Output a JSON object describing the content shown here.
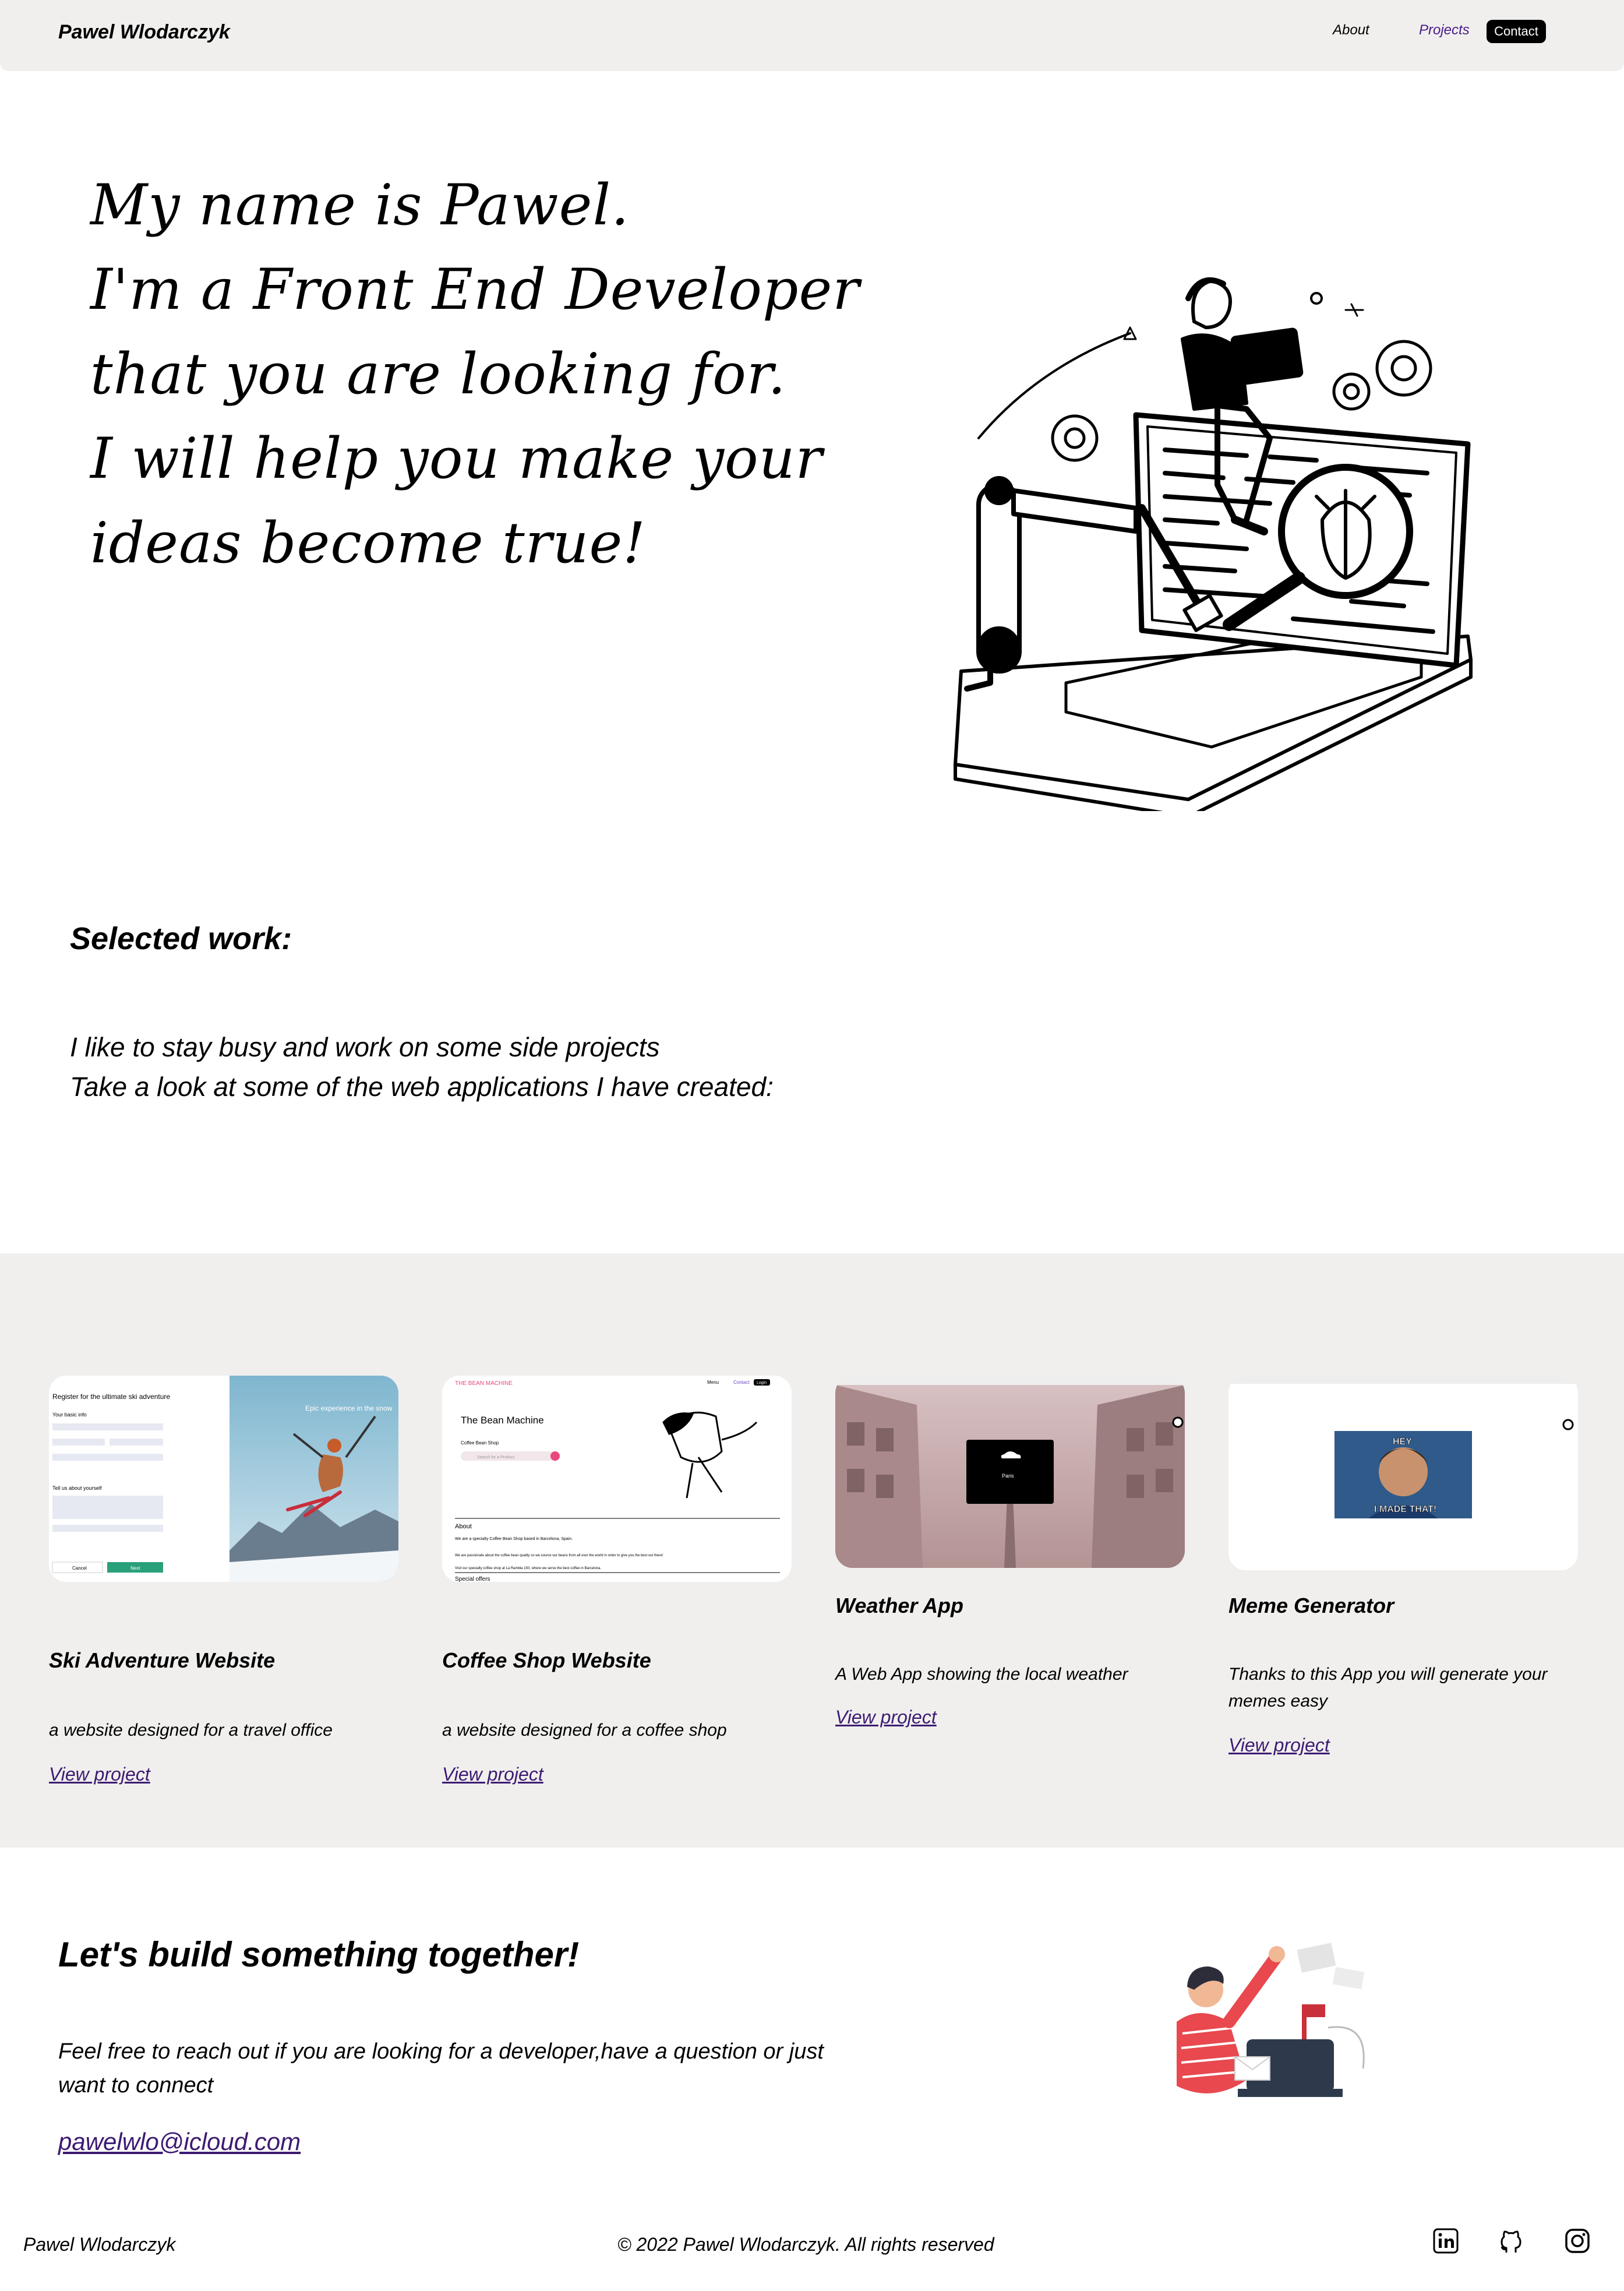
{
  "header": {
    "brand": "Pawel Wlodarczyk",
    "nav": {
      "about": "About",
      "projects": "Projects",
      "contact": "Contact"
    }
  },
  "hero": {
    "lines": [
      "My name is Pawel.",
      "I'm a Front End Developer",
      "that you are looking for.",
      "I will help you make your",
      "ideas become true!"
    ],
    "illustration": "developer-laptop-bug-illustration"
  },
  "selected": {
    "title": "Selected work:",
    "lines": [
      "I like to stay busy and work on some side projects",
      "Take a look at some of the web applications I have created:"
    ]
  },
  "projects": [
    {
      "title": "Ski Adventure Website",
      "desc": "a website designed for a travel office",
      "link": "View project",
      "thumb": {
        "form_title": "Register for the ultimate ski adventure",
        "basic_info": "Your basic info",
        "tell_us": "Tell us about yourself",
        "hero_text": "Epic experience in the snow",
        "cancel": "Cancel",
        "next": "Next"
      }
    },
    {
      "title": "Coffee Shop Website",
      "desc": "a website designed for a coffee shop",
      "link": "View project",
      "thumb": {
        "logo": "THE BEAN MACHINE",
        "heading": "The Bean Machine",
        "subheading": "Coffee Bean Shop",
        "search": "Search for a Product",
        "about": "About",
        "p1": "We are a specialty Coffee Bean Shop based in Barcelona, Spain.",
        "p2": "We are passionate about the coffee bean quality so we source our beans from all over the world in order to give you the best out there!",
        "p3": "Visit our specialty coffee shop at La Rambla 150, where we serve the best coffee in Barcelona.",
        "special": "Special offers",
        "nav_menu": "Menu",
        "nav_contact": "Contact",
        "nav_login": "Login"
      }
    },
    {
      "title": "Weather App",
      "desc": "A Web App showing the local weather",
      "link": "View project",
      "thumb": {
        "city": "Paris"
      }
    },
    {
      "title": "Meme Generator",
      "desc": "Thanks to this App you will generate your memes easy",
      "link": "View project",
      "thumb": {
        "top_text": "HEY",
        "bottom_text": "I MADE THAT!"
      }
    }
  ],
  "contact": {
    "title": "Let's build something together!",
    "text": "Feel free to reach out if you are looking for a developer,have a question or just want to connect",
    "email": "pawelwlo@icloud.com",
    "illustration": "person-mailbox-illustration"
  },
  "footer": {
    "name": "Pawel Wlodarczyk",
    "copyright": "© 2022 Pawel Wlodarczyk. All rights reserved",
    "icons": [
      "linkedin-icon",
      "github-icon",
      "instagram-icon"
    ]
  },
  "colors": {
    "band": "#f0efee",
    "link": "#3d1b73",
    "nav_active": "#4a1a8a",
    "contact_btn": "#000000"
  }
}
